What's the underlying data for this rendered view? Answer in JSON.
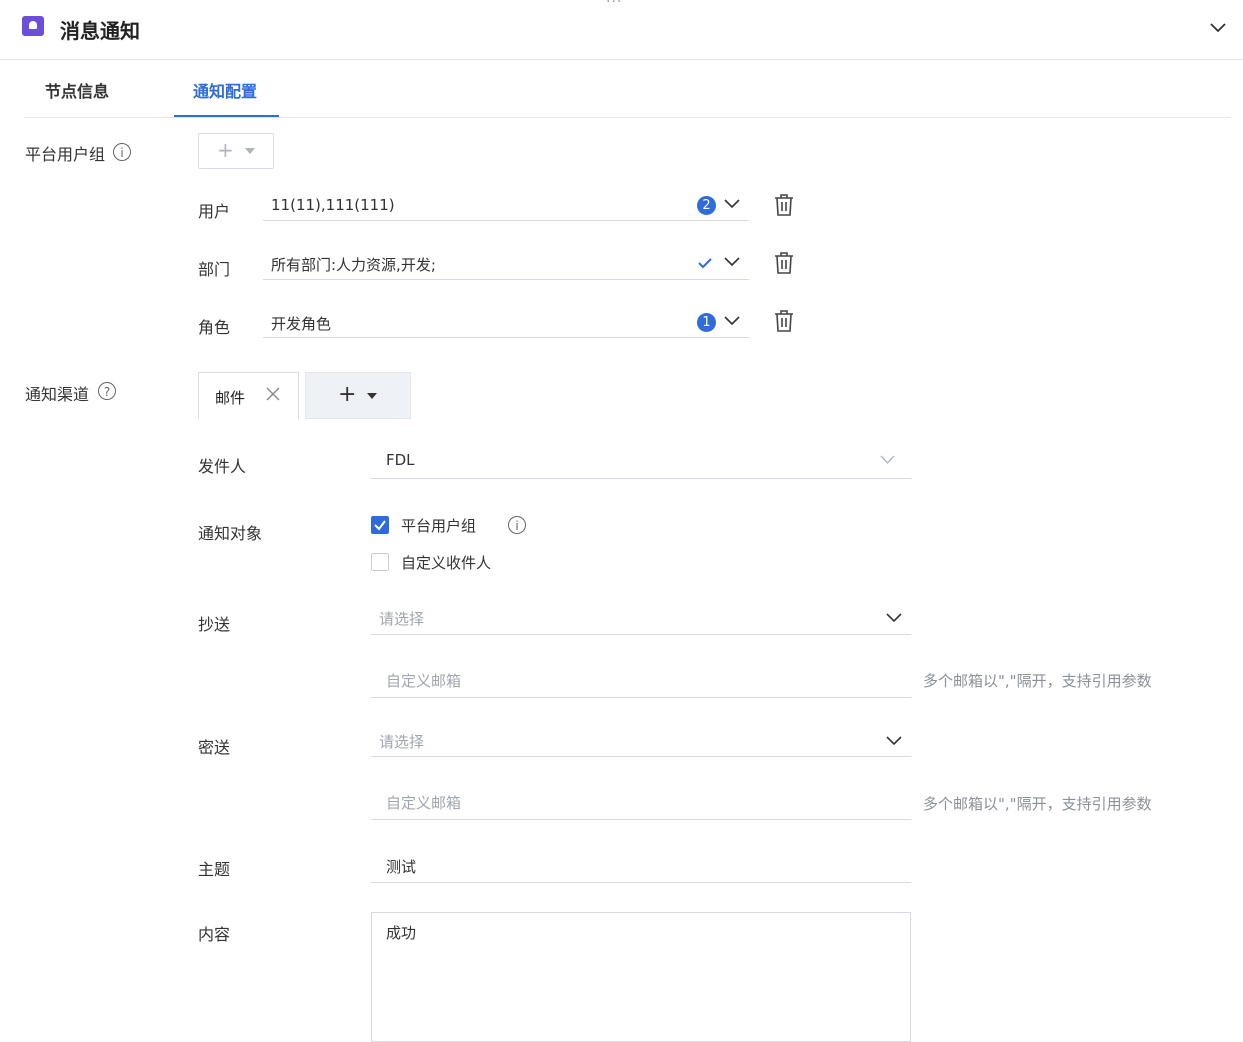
{
  "header": {
    "title": "消息通知",
    "handle": "···"
  },
  "tabs": [
    {
      "label": "节点信息",
      "active": false
    },
    {
      "label": "通知配置",
      "active": true
    }
  ],
  "platform_group": {
    "label": "平台用户组",
    "add_button": "+",
    "rows": [
      {
        "label": "用户",
        "value": "11(11),111(111)",
        "badge": "2"
      },
      {
        "label": "部门",
        "value": "所有部门:人力资源,开发;",
        "badge": ""
      },
      {
        "label": "角色",
        "value": "开发角色",
        "badge": "1"
      }
    ]
  },
  "channel": {
    "label": "通知渠道",
    "chip": "邮件",
    "add_button": "+"
  },
  "form": {
    "sender": {
      "label": "发件人",
      "value": "FDL"
    },
    "target": {
      "label": "通知对象",
      "options": [
        {
          "label": "平台用户组",
          "checked": true
        },
        {
          "label": "自定义收件人",
          "checked": false
        }
      ]
    },
    "cc": {
      "label": "抄送",
      "select_placeholder": "请选择",
      "input_placeholder": "自定义邮箱",
      "hint": "多个邮箱以\",\"隔开，支持引用参数"
    },
    "bcc": {
      "label": "密送",
      "select_placeholder": "请选择",
      "input_placeholder": "自定义邮箱",
      "hint": "多个邮箱以\",\"隔开，支持引用参数"
    },
    "subject": {
      "label": "主题",
      "value": "测试"
    },
    "content": {
      "label": "内容",
      "value": "成功"
    }
  },
  "colors": {
    "accent": "#2f6bd9",
    "brand_icon": "#6b4fd8"
  }
}
